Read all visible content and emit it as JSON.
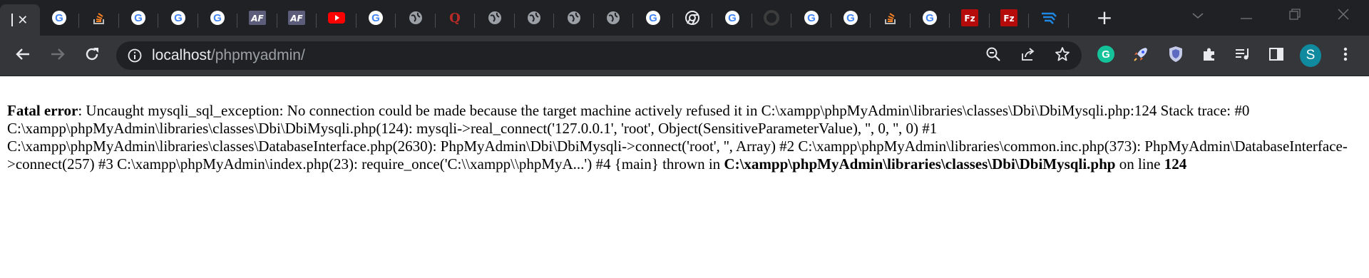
{
  "tabs": [
    {
      "icon": "active-tab-indicator",
      "active": true,
      "close": "✕"
    },
    {
      "icon": "google-icon"
    },
    {
      "icon": "stackoverflow-icon"
    },
    {
      "icon": "google-icon"
    },
    {
      "icon": "google-icon"
    },
    {
      "icon": "google-icon"
    },
    {
      "icon": "af-icon",
      "text": "AF"
    },
    {
      "icon": "af-icon",
      "text": "AF"
    },
    {
      "icon": "youtube-icon"
    },
    {
      "icon": "google-icon"
    },
    {
      "icon": "globe-icon"
    },
    {
      "icon": "quora-icon",
      "text": "Q"
    },
    {
      "icon": "globe-icon"
    },
    {
      "icon": "globe-icon"
    },
    {
      "icon": "globe-icon"
    },
    {
      "icon": "globe-icon"
    },
    {
      "icon": "google-icon"
    },
    {
      "icon": "chrome-icon"
    },
    {
      "icon": "google-icon"
    },
    {
      "icon": "loading-icon"
    },
    {
      "icon": "google-icon"
    },
    {
      "icon": "google-icon"
    },
    {
      "icon": "stackoverflow-icon"
    },
    {
      "icon": "google-icon"
    },
    {
      "icon": "filezilla-icon",
      "text": "Fz"
    },
    {
      "icon": "filezilla-icon",
      "text": "Fz"
    },
    {
      "icon": "blue-stripes-icon"
    }
  ],
  "new_tab": "+",
  "address": {
    "host": "localhost",
    "path": "/phpmyadmin/"
  },
  "profile_initial": "S",
  "colors": {
    "accent": "#0f8a9e",
    "chrome_dark": "#202124",
    "toolbar": "#35363a",
    "google_red": "#ea4335",
    "youtube_red": "#ff0000",
    "filezilla_red": "#b50b0b"
  },
  "error": {
    "label": "Fatal error",
    "message": ": Uncaught mysqli_sql_exception: No connection could be made because the target machine actively refused it in C:\\xampp\\phpMyAdmin\\libraries\\classes\\Dbi\\DbiMysqli.php:124 Stack trace: #0 C:\\xampp\\phpMyAdmin\\libraries\\classes\\Dbi\\DbiMysqli.php(124): mysqli->real_connect('127.0.0.1', 'root', Object(SensitiveParameterValue), '', 0, '', 0) #1 C:\\xampp\\phpMyAdmin\\libraries\\classes\\DatabaseInterface.php(2630): PhpMyAdmin\\Dbi\\DbiMysqli->connect('root', '', Array) #2 C:\\xampp\\phpMyAdmin\\libraries\\common.inc.php(373): PhpMyAdmin\\DatabaseInterface->connect(257) #3 C:\\xampp\\phpMyAdmin\\index.php(23): require_once('C:\\\\xampp\\\\phpMyA...') #4 {main} thrown in ",
    "file": "C:\\xampp\\phpMyAdmin\\libraries\\classes\\Dbi\\DbiMysqli.php",
    "on_line": " on line ",
    "line": "124"
  }
}
